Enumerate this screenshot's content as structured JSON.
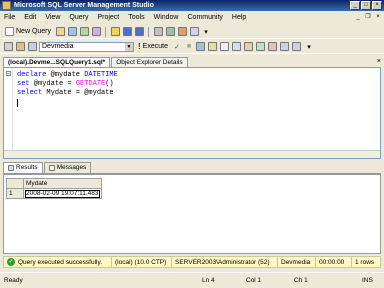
{
  "window": {
    "title": "Microsoft SQL Server Management Studio"
  },
  "menu": [
    "File",
    "Edit",
    "View",
    "Query",
    "Project",
    "Tools",
    "Window",
    "Community",
    "Help"
  ],
  "toolbar": {
    "new_query_label": "New Query",
    "database": "Devmedia",
    "execute_label": "Execute"
  },
  "doc_tabs": [
    {
      "label": "(local).Devme...SQLQuery1.sql*",
      "active": true
    },
    {
      "label": "Object Explorer Details",
      "active": false
    }
  ],
  "editor": {
    "lines": [
      [
        "declare",
        " @mydate ",
        "DATETIME"
      ],
      [
        "set",
        " @mydate = ",
        "GETDATE",
        "()"
      ],
      [
        "select",
        " Mydate = @mydate"
      ]
    ]
  },
  "result_tabs": {
    "results": "Results",
    "messages": "Messages"
  },
  "results": {
    "column": "Mydate",
    "row_number": "1",
    "value": "2008-02-09 19:07:11.483"
  },
  "query_status": {
    "message": "Query executed successfully.",
    "server": "(local) (10.0 CTP)",
    "user": "SERVER2003\\Administrator (52)",
    "database": "Devmedia",
    "elapsed": "00:00:00",
    "rows": "1 rows"
  },
  "status_bar": {
    "ready": "Ready",
    "ln": "Ln 4",
    "col": "Col 1",
    "ch": "Ch 1",
    "ins": "INS"
  },
  "colors": {
    "keyword": "#0000ff",
    "function": "#ff00ff",
    "titlebar": "#0a246a",
    "status_bg": "#fff8c4"
  }
}
